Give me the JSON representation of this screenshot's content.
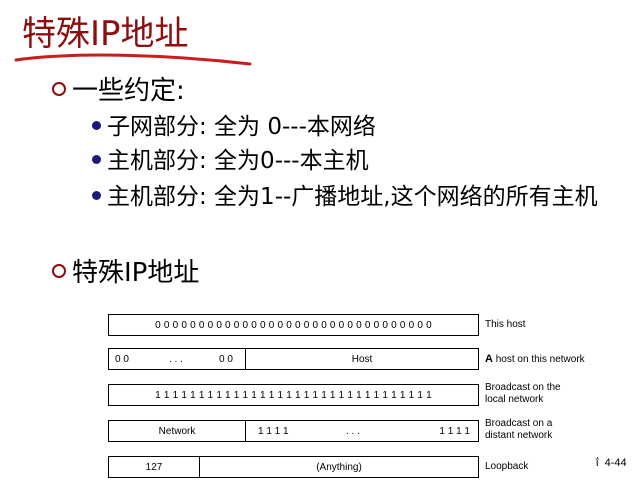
{
  "slide": {
    "title": "特殊IP地址",
    "page_number": "4-44",
    "page_mark": "ΐ"
  },
  "bullets": [
    {
      "level": 1,
      "text": "一些约定:"
    },
    {
      "level": 2,
      "text": "子网部分: 全为 0---本网络"
    },
    {
      "level": 2,
      "text": "主机部分: 全为0---本主机"
    },
    {
      "level": 2,
      "text": "主机部分: 全为1--广播地址,这个网络的所有主机"
    },
    {
      "level": 1,
      "text": "特殊IP地址"
    }
  ],
  "diagram": {
    "rows": [
      {
        "cells": [
          "0 0 0 0 0 0 0 0 0 0 0 0 0 0 0 0 0 0 0 0 0 0 0 0 0 0 0 0 0 0 0 0"
        ],
        "desc_bold": "",
        "desc": "This host"
      },
      {
        "cells": [
          "0 0",
          ". . .",
          "0 0",
          "Host"
        ],
        "desc_bold": "A",
        "desc": " host on this network"
      },
      {
        "cells": [
          "1 1 1 1 1 1 1 1 1 1 1 1 1 1 1 1 1 1 1 1 1 1 1 1 1 1 1 1 1 1 1 1"
        ],
        "desc_bold": "",
        "desc": "Broadcast on the",
        "desc2": "local network"
      },
      {
        "cells": [
          "Network",
          "1 1 1 1",
          ". . .",
          "1 1 1 1"
        ],
        "desc_bold": "",
        "desc": "Broadcast on a",
        "desc2": "distant network"
      },
      {
        "cells": [
          "127",
          "(Anything)"
        ],
        "desc_bold": "",
        "desc": "Loopback"
      }
    ]
  },
  "colors": {
    "title": "#8b0f0f",
    "underline": "#c81e1e",
    "l1_marker": "#8b0f0f",
    "l2_marker": "#1a1a7a"
  }
}
